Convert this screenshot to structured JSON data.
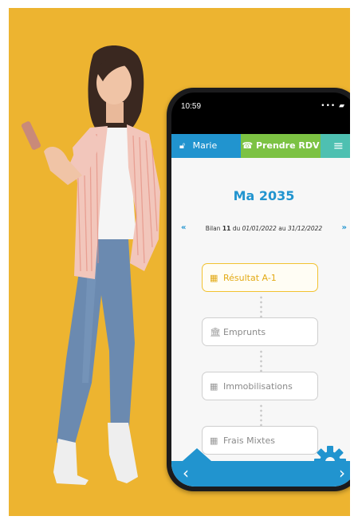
{
  "phone": {
    "time": "10:59",
    "status_icons": "••• ▰"
  },
  "app": {
    "user_name": "Marie",
    "rdv_label": "Prendre RDV",
    "title": "Ma 2035",
    "period": {
      "prefix": "Bilan",
      "number": "11",
      "du": "du",
      "start": "01/01/2022",
      "au": "au",
      "end": "31/12/2022"
    },
    "steps": [
      {
        "label": "Résultat A-1",
        "icon": "calculator-icon",
        "glyph": "▦"
      },
      {
        "label": "Emprunts",
        "icon": "bank-icon",
        "glyph": "🏛"
      },
      {
        "label": "Immobilisations",
        "icon": "table-icon",
        "glyph": "▦"
      },
      {
        "label": "Frais Mixtes",
        "icon": "table-icon",
        "glyph": "▦"
      }
    ]
  },
  "colors": {
    "background": "#edb430",
    "primary": "#2194cf",
    "green": "#7cc243",
    "teal": "#4ec0b1",
    "active": "#f2c230"
  }
}
